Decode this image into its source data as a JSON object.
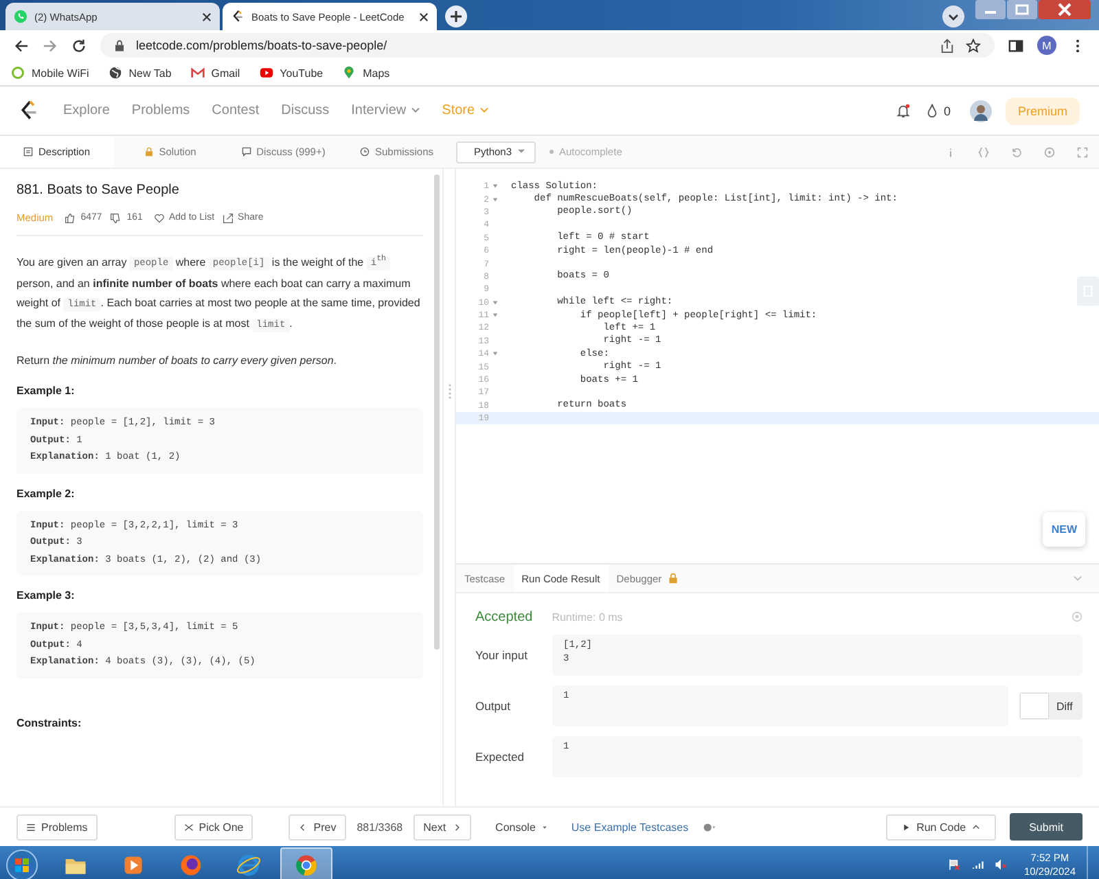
{
  "browser": {
    "tabs": [
      {
        "title": "(2) WhatsApp",
        "kind": "chat",
        "selected": false
      },
      {
        "title": "Boats to Save People - LeetCode",
        "kind": "site",
        "selected": true
      }
    ],
    "url": "leetcode.com/problems/boats-to-save-people/",
    "profile_initial": "M",
    "bookmarks": [
      {
        "label": "Mobile WiFi",
        "kind": "ring"
      },
      {
        "label": "New Tab",
        "kind": "globe"
      },
      {
        "label": "Gmail",
        "kind": "mail"
      },
      {
        "label": "YouTube",
        "kind": "video"
      },
      {
        "label": "Maps",
        "kind": "pin"
      }
    ]
  },
  "nav": {
    "items": [
      {
        "label": "Explore",
        "highlighted": false,
        "dropdown": false
      },
      {
        "label": "Problems",
        "highlighted": false,
        "dropdown": false
      },
      {
        "label": "Contest",
        "highlighted": false,
        "dropdown": false
      },
      {
        "label": "Discuss",
        "highlighted": false,
        "dropdown": false
      },
      {
        "label": "Interview",
        "highlighted": false,
        "dropdown": true
      },
      {
        "label": "Store",
        "highlighted": true,
        "dropdown": true
      }
    ],
    "streak": "0",
    "premium": "Premium"
  },
  "problem_tabs": [
    {
      "label": "Description",
      "kind": "description",
      "selected": true
    },
    {
      "label": "Solution",
      "kind": "solution",
      "selected": false
    },
    {
      "label": "Discuss (999+)",
      "kind": "discuss",
      "selected": false
    },
    {
      "label": "Submissions",
      "kind": "submissions",
      "selected": false
    }
  ],
  "problem": {
    "title": "881. Boats to Save People",
    "difficulty": "Medium",
    "likes": "6477",
    "dislikes": "161",
    "add_to_list": "Add to List",
    "share": "Share",
    "statement": [
      {
        "kind": "text",
        "text": "You are given an array "
      },
      {
        "kind": "code",
        "text": "people"
      },
      {
        "kind": "text",
        "text": " where "
      },
      {
        "kind": "code",
        "text": "people[i]"
      },
      {
        "kind": "text",
        "text": " is the weight of the "
      },
      {
        "kind": "code",
        "text": "i$^{th}$"
      },
      {
        "kind": "text",
        "text": " person, and an **infinite number of boats** where each boat can carry a maximum weight of "
      },
      {
        "kind": "code",
        "text": "limit"
      },
      {
        "kind": "text",
        "text": ". Each boat carries at most two people at the same time, provided the sum of the weight of those people is at most "
      },
      {
        "kind": "code",
        "text": "limit"
      },
      {
        "kind": "text",
        "text": "."
      }
    ],
    "return_text": "Return *the minimum number of boats to carry every given person*.",
    "examples": [
      {
        "title": "Example 1:",
        "lines": [
          {
            "label": "Input:",
            "value": "people = [1,2], limit = 3"
          },
          {
            "label": "Output:",
            "value": "1"
          },
          {
            "label": "Explanation:",
            "value": "1 boat (1, 2)"
          }
        ]
      },
      {
        "title": "Example 2:",
        "lines": [
          {
            "label": "Input:",
            "value": "people = [3,2,2,1], limit = 3"
          },
          {
            "label": "Output:",
            "value": "3"
          },
          {
            "label": "Explanation:",
            "value": "3 boats (1, 2), (2) and (3)"
          }
        ]
      },
      {
        "title": "Example 3:",
        "lines": [
          {
            "label": "Input:",
            "value": "people = [3,5,3,4], limit = 5"
          },
          {
            "label": "Output:",
            "value": "4"
          },
          {
            "label": "Explanation:",
            "value": "4 boats (3), (3), (4), (5)"
          }
        ]
      }
    ],
    "constraints_heading": "Constraints:"
  },
  "editor": {
    "language": "Python3",
    "autocomplete": "Autocomplete",
    "new_badge": "NEW",
    "lines": [
      {
        "num": "1",
        "text": "class Solution:",
        "foldable": true,
        "current": false
      },
      {
        "num": "2",
        "text": "    def numRescueBoats(self, people: List[int], limit: int) -> int:",
        "foldable": true,
        "current": false
      },
      {
        "num": "3",
        "text": "        people.sort()",
        "foldable": false,
        "current": false
      },
      {
        "num": "4",
        "foldable": false,
        "current": false
      },
      {
        "num": "5",
        "text": "        left = 0 # start",
        "foldable": false,
        "current": false
      },
      {
        "num": "6",
        "text": "        right = len(people)-1 # end",
        "foldable": false,
        "current": false
      },
      {
        "num": "7",
        "foldable": false,
        "current": false
      },
      {
        "num": "8",
        "text": "        boats = 0",
        "foldable": false,
        "current": false
      },
      {
        "num": "9",
        "foldable": false,
        "current": false
      },
      {
        "num": "10",
        "text": "        while left <= right:",
        "foldable": true,
        "current": false
      },
      {
        "num": "11",
        "text": "            if people[left] + people[right] <= limit:",
        "foldable": true,
        "current": false
      },
      {
        "num": "12",
        "text": "                left += 1",
        "foldable": false,
        "current": false
      },
      {
        "num": "13",
        "text": "                right -= 1",
        "foldable": false,
        "current": false
      },
      {
        "num": "14",
        "text": "            else:",
        "foldable": true,
        "current": false
      },
      {
        "num": "15",
        "text": "                right -= 1",
        "foldable": false,
        "current": false
      },
      {
        "num": "16",
        "text": "            boats += 1",
        "foldable": false,
        "current": false
      },
      {
        "num": "17",
        "foldable": false,
        "current": false
      },
      {
        "num": "18",
        "text": "        return boats",
        "foldable": false,
        "current": false
      },
      {
        "num": "19",
        "foldable": false,
        "current": true
      }
    ]
  },
  "result": {
    "tabs": [
      {
        "label": "Testcase",
        "selected": false,
        "locked": false
      },
      {
        "label": "Run Code Result",
        "selected": true,
        "locked": false
      },
      {
        "label": "Debugger",
        "selected": false,
        "locked": true
      }
    ],
    "status": "Accepted",
    "runtime": "Runtime: 0 ms",
    "rows": [
      {
        "label": "Your input",
        "lines": [
          "[1,2]",
          "3"
        ]
      },
      {
        "label": "Output",
        "lines": [
          "1"
        ],
        "toggle": {
          "label": "Diff",
          "on": false
        }
      },
      {
        "label": "Expected",
        "lines": [
          "1"
        ]
      }
    ]
  },
  "bottom_bar": {
    "problems": "Problems",
    "pick_one": "Pick One",
    "prev": "Prev",
    "position": "881/3368",
    "next": "Next",
    "console": "Console",
    "use_example": "Use Example Testcases",
    "run_code": "Run Code",
    "submit": "Submit"
  },
  "taskbar": {
    "apps": [
      {
        "kind": "folder",
        "selected": false
      },
      {
        "kind": "media",
        "selected": false
      },
      {
        "kind": "fox",
        "selected": false
      },
      {
        "kind": "ie",
        "selected": false
      },
      {
        "kind": "chrome",
        "selected": true
      }
    ],
    "time": "7:52 PM",
    "date": "10/29/2024"
  }
}
